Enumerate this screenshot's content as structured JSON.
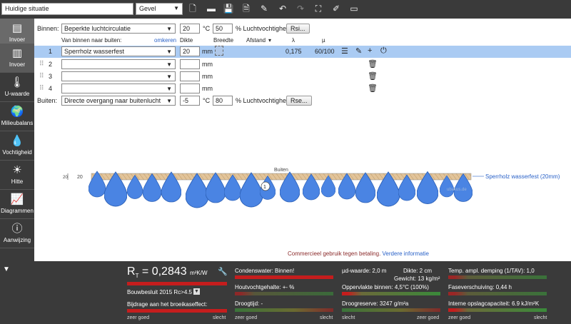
{
  "toolbar": {
    "project_name": "Huidige situatie",
    "view_selected": "Gevel",
    "icons": [
      "new-file-icon",
      "open-folder-icon",
      "save-icon",
      "pdf-icon",
      "edit-icon",
      "undo-icon",
      "redo-icon",
      "fullscreen-icon",
      "magic-icon",
      "comment-icon"
    ]
  },
  "sidebar": {
    "items": [
      {
        "label": "Invoer",
        "icon": "layers-icon"
      },
      {
        "label": "Invoer",
        "icon": "layers-icon"
      },
      {
        "label": "U-waarde",
        "icon": "thermometer-icon"
      },
      {
        "label": "Milieubalans",
        "icon": "globe-icon"
      },
      {
        "label": "Vochtigheid",
        "icon": "drop-icon"
      },
      {
        "label": "Hitte",
        "icon": "sun-icon"
      },
      {
        "label": "Diagrammen",
        "icon": "chart-icon"
      },
      {
        "label": "Aanwijzing",
        "icon": "info-icon"
      }
    ]
  },
  "inner": {
    "label": "Binnen:",
    "selected": "Beperkte luchtcirculatie",
    "temp": "20",
    "temp_unit": "°C",
    "humidity": "50",
    "humidity_unit": "% Luchtvochtigheid",
    "button": "Rsi..."
  },
  "headers": {
    "from": "Van binnen naar buiten:",
    "reverse": "omkeren",
    "thickness": "Dikte",
    "width": "Breedte",
    "distance": "Afstand",
    "lambda": "λ",
    "mu": "µ"
  },
  "layers": [
    {
      "num": "1",
      "material": "Sperrholz wasserfest",
      "thickness": "20",
      "unit": "mm",
      "lambda": "0,175",
      "mu": "60/100"
    },
    {
      "num": "2",
      "material": "",
      "thickness": "",
      "unit": "mm"
    },
    {
      "num": "3",
      "material": "",
      "thickness": "",
      "unit": "mm"
    },
    {
      "num": "4",
      "material": "",
      "thickness": "",
      "unit": "mm"
    }
  ],
  "outer": {
    "label": "Buiten:",
    "selected": "Directe overgang naar buitenlucht",
    "temp": "-5",
    "temp_unit": "°C",
    "humidity": "80",
    "humidity_unit": "% Luchtvochtigheid",
    "button": "Rse..."
  },
  "diagram": {
    "dim_left": "20",
    "dim_right": "20",
    "outside_label": "Buiten",
    "marker": "1",
    "layer_label": "Sperrholz wasserfest (20mm)",
    "watermark": "ubakus.de"
  },
  "notice": {
    "text": "Commercieel gebruik tegen betaling.",
    "link": "Verdere informatie"
  },
  "results": {
    "rt_symbol": "R",
    "rt_sub": "T",
    "rt_value": "= 0,2843",
    "rt_unit": "m²K/W",
    "standard": "Bouwbesluit 2015 Rc>4.5",
    "greenhouse": "Bijdrage aan het broeikaseffect:",
    "good": "zeer goed",
    "bad": "slecht",
    "condensate": "Condenswater: Binnen!",
    "wood_moisture": "Houtvochtgehalte: +- %",
    "drying": "Droogtijd: -",
    "sd": "µd-waarde: 2,0 m",
    "thickness": "Dikte: 2 cm",
    "weight": "Gewicht: 13 kg/m²",
    "surface_temp": "Oppervlakte binnen: 4,5°C (100%)",
    "drying_reserve": "Droogreserve: 3247 g/m²a",
    "damping": "Temp. ampl. demping (1/TAV): 1,0",
    "phase": "Faseverschuiving: 0,44 h",
    "storage": "Interne opslagcapaciteit: 6.9 kJ/m²K"
  },
  "colors": {
    "dark": "#3a3a3a",
    "highlight": "#aacbf3",
    "drop": "#4a84e3",
    "red": "#c51d1d",
    "link": "#2a62c8"
  }
}
